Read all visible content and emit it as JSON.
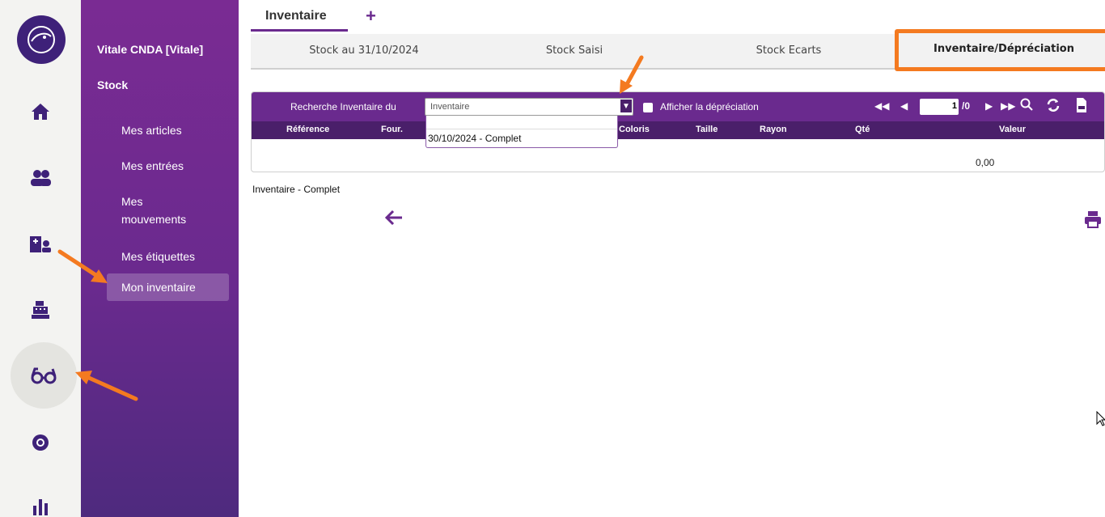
{
  "sidebar": {
    "title": "Vitale CNDA [Vitale]",
    "section": "Stock",
    "items": [
      {
        "label": "Mes articles"
      },
      {
        "label": "Mes entrées"
      },
      {
        "label": "Mes mouvements"
      },
      {
        "label": "Mes étiquettes"
      },
      {
        "label": "Mon inventaire"
      }
    ],
    "active_item": "Mon inventaire"
  },
  "rail": {
    "icons": [
      "logo-icon",
      "home-icon",
      "users-icon",
      "patient-record-icon",
      "cash-register-icon",
      "glasses-icon",
      "eye-icon",
      "bar-chart-icon"
    ],
    "active": "glasses-icon"
  },
  "tabs": {
    "main": "Inventaire",
    "add": "+"
  },
  "subtabs": [
    {
      "label": "Stock au 31/10/2024"
    },
    {
      "label": "Stock Saisi"
    },
    {
      "label": "Stock Ecarts"
    },
    {
      "label": "Inventaire/Dépréciation"
    }
  ],
  "toolbar": {
    "search_label": "Recherche Inventaire du",
    "select_value": "Inventaire",
    "checkbox_label": "Afficher la dépréciation",
    "page_current": "1",
    "page_total": "/0"
  },
  "grid": {
    "columns": [
      "Référence",
      "Four.",
      "Coloris",
      "Taille",
      "Rayon",
      "Qté",
      "Valeur"
    ],
    "total_value": "0,00"
  },
  "dropdown": {
    "options": [
      "30/10/2024 - Complet"
    ]
  },
  "caption": "Inventaire - Complet",
  "colors": {
    "purple": "#6a2a8e",
    "dark_purple": "#4a1f6a",
    "annotation_orange": "#f47a20"
  }
}
